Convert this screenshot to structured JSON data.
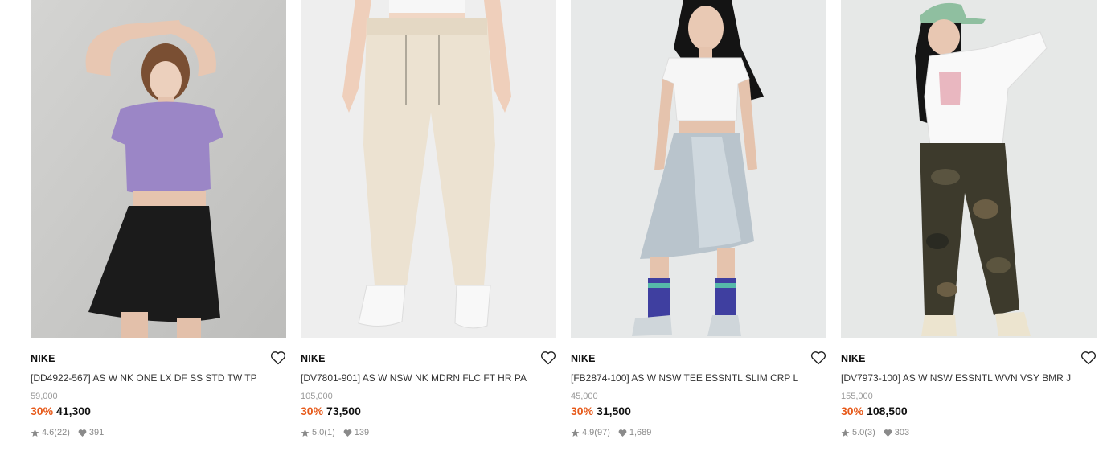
{
  "colors": {
    "discount": "#e75a1a",
    "text": "#111111",
    "muted": "#8a8a8a"
  },
  "products": [
    {
      "brand": "NIKE",
      "title": "[DD4922-567] AS W NK ONE LX DF SS STD TW TP",
      "original_price": "59,000",
      "discount": "30%",
      "price": "41,300",
      "rating": "4.6",
      "reviews": "(22)",
      "likes": "391",
      "image": "model-purple-top-black-skirt"
    },
    {
      "brand": "NIKE",
      "title": "[DV7801-901] AS W NSW NK MDRN FLC FT HR PA",
      "original_price": "105,000",
      "discount": "30%",
      "price": "73,500",
      "rating": "5.0",
      "reviews": "(1)",
      "likes": "139",
      "image": "cream-fleece-pants"
    },
    {
      "brand": "NIKE",
      "title": "[FB2874-100] AS W NSW TEE ESSNTL SLIM CRP L",
      "original_price": "45,000",
      "discount": "30%",
      "price": "31,500",
      "rating": "4.9",
      "reviews": "(97)",
      "likes": "1,689",
      "image": "model-white-crop-satin-skirt"
    },
    {
      "brand": "NIKE",
      "title": "[DV7973-100] AS W NSW ESSNTL WVN VSY BMR J",
      "original_price": "155,000",
      "discount": "30%",
      "price": "108,500",
      "rating": "5.0",
      "reviews": "(3)",
      "likes": "303",
      "image": "model-white-jacket-camo-pants"
    }
  ]
}
